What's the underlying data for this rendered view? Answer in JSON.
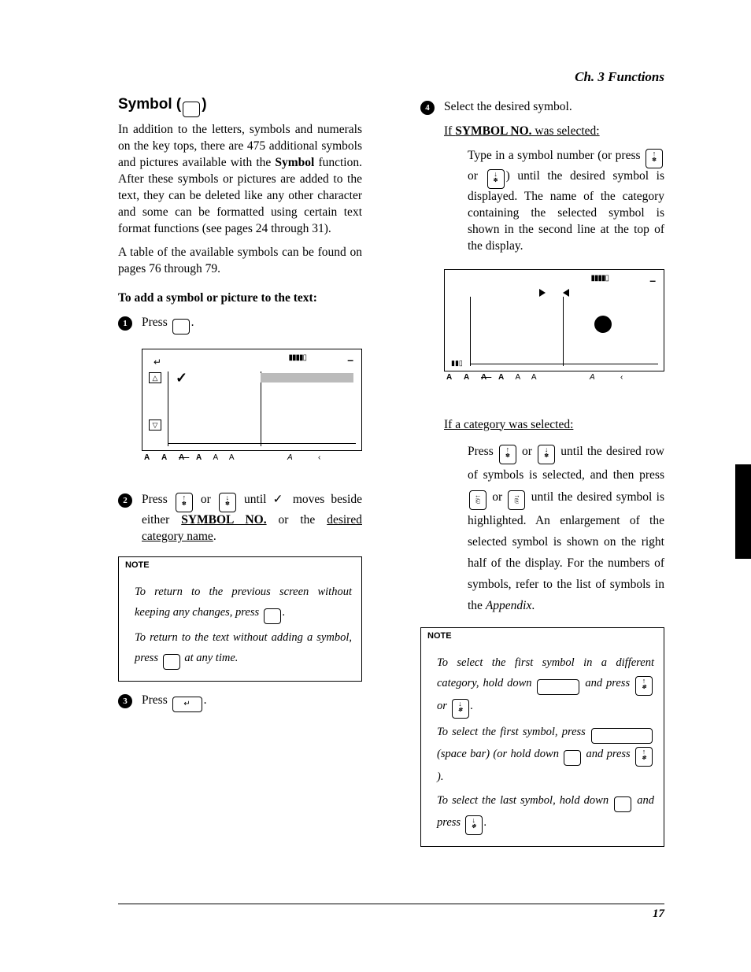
{
  "chapter": "Ch. 3 Functions",
  "page_number": "17",
  "section_title_pre": "Symbol (",
  "section_title_post": ")",
  "intro_p1_a": "In addition to the letters, symbols and numerals on the key tops, there are 475 additional symbols and pictures available with the ",
  "intro_p1_bold": "Symbol",
  "intro_p1_b": " function. After these symbols or pictures are added to the text, they can be deleted like any other character and some can be formatted using certain text format functions (see pages 24 through 31).",
  "intro_p2": "A table of the available symbols can be found on pages 76 through 79.",
  "subhead_add": "To add a symbol or picture to the text:",
  "step1_a": "Press ",
  "step1_b": ".",
  "step2_a": "Press ",
  "step2_or": " or ",
  "step2_b": " until ",
  "step2_c": " moves beside either ",
  "step2_bold": "SYMBOL NO.",
  "step2_d": " or the ",
  "step2_link": "desired category name",
  "step2_e": ".",
  "note1_head": "NOTE",
  "note1_p1_a": "To return to the previous screen without keeping any changes, press ",
  "note1_p1_b": ".",
  "note1_p2_a": "To return to the text without adding a symbol, press ",
  "note1_p2_b": " at any time.",
  "step3_a": "Press ",
  "step3_b": ".",
  "step4_a": "Select the desired symbol.",
  "step4_if1_head": "If ",
  "step4_if1_bold": "SYMBOL NO.",
  "step4_if1_tail": " was selected:",
  "step4_if1_p_a": "Type in a symbol number (or press ",
  "step4_if1_p_b": " or ",
  "step4_if1_p_c": ") until the desired symbol is displayed. The name of the category containing the selected symbol is shown in the second line at the top of the display.",
  "step4_if2_head": "If a category was selected:",
  "step4_if2_p_a": "Press ",
  "step4_if2_p_b": " or ",
  "step4_if2_p_c": " until the desired row of symbols is selected, and then press ",
  "step4_if2_p_d": " or ",
  "step4_if2_p_e": " until the desired symbol is highlighted. An enlargement of the selected symbol is shown on the right half of the display. For the numbers of symbols, refer to the list of symbols in the ",
  "step4_if2_appendix": "Appendix",
  "step4_if2_p_f": ".",
  "note2_head": "NOTE",
  "note2_p1_a": "To select the first symbol in a different category, hold down ",
  "note2_p1_b": " and press ",
  "note2_p1_c": " or ",
  "note2_p1_d": ".",
  "note2_p2_a": "To select the first symbol, press ",
  "note2_p2_b": " (space bar) (or hold down ",
  "note2_p2_c": " and press ",
  "note2_p2_d": ").",
  "note2_p3_a": "To select the last symbol, hold down ",
  "note2_p3_b": " and press ",
  "note2_p3_c": ".",
  "key_up_top": "↑",
  "key_up_bot": "✽",
  "key_down_top": "↓",
  "key_down_bot": "✽",
  "key_left_top": "←",
  "key_left_bot": "⎗",
  "key_right_top": "→",
  "key_right_bot": "⎘",
  "key_enter": "↵",
  "check": "✓",
  "screen_status": "A A A A A A           A      ‹"
}
